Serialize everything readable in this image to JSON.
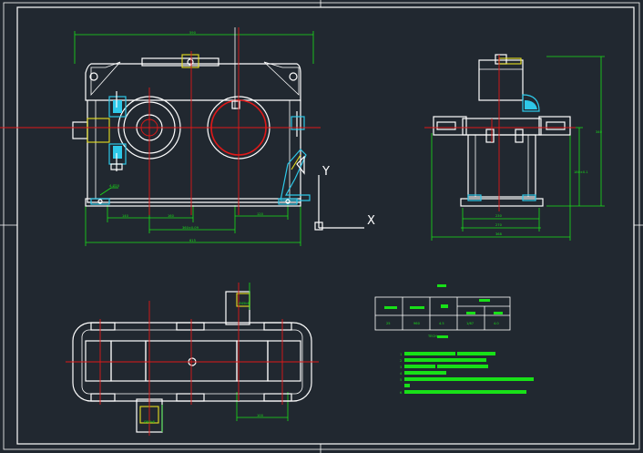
{
  "drawing": {
    "background": "#212830",
    "line_colors": {
      "outline": "#ffffff",
      "center": "#e01818",
      "dimension": "#18e018",
      "hatch": "#2ec8e8",
      "detail": "#e8e020"
    }
  },
  "ucs": {
    "x_label": "X",
    "y_label": "Y"
  },
  "front_view": {
    "dims": {
      "overall_top": "590",
      "overall_bottom": "615",
      "center_distance": "160",
      "span_a": "140",
      "span_b": "160",
      "span_c": "120",
      "span_d": "360±0.09"
    },
    "note_left": "4-Ø20"
  },
  "side_view": {
    "dims": {
      "height_total": "340",
      "height_center": "180±0.1",
      "width_a": "230",
      "width_b": "270",
      "width_c": "368"
    }
  },
  "top_view": {
    "dims": {
      "shaft_out": "Ø45k6",
      "shaft_in": "Ø60k6",
      "key_len": "100"
    }
  },
  "spec_table": {
    "headers": [
      "i",
      "n",
      "P",
      "z",
      "m"
    ],
    "values": [
      "25",
      "960",
      "4.5",
      "1/67",
      "4.0"
    ]
  },
  "notes": {
    "title": "TECH",
    "lines": [
      "1",
      "2",
      "3",
      "4",
      "5",
      "6"
    ]
  }
}
